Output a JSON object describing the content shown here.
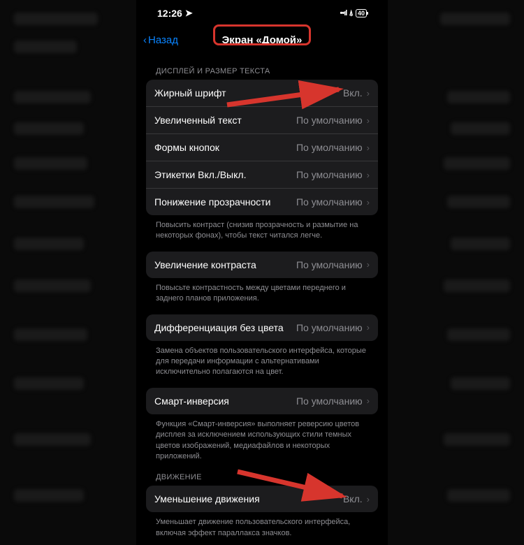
{
  "statusBar": {
    "time": "12:26",
    "batteryPct": "40"
  },
  "nav": {
    "back": "Назад",
    "title": "Экран «Домой»"
  },
  "sections": {
    "displayHeader": "ДИСПЛЕЙ И РАЗМЕР ТЕКСТА",
    "rows": {
      "bold": {
        "label": "Жирный шрифт",
        "value": "Вкл."
      },
      "larger": {
        "label": "Увеличенный текст",
        "value": "По умолчанию"
      },
      "buttonShapes": {
        "label": "Формы кнопок",
        "value": "По умолчанию"
      },
      "labels": {
        "label": "Этикетки Вкл./Выкл.",
        "value": "По умолчанию"
      },
      "reduceTransparency": {
        "label": "Понижение прозрачности",
        "value": "По умолчанию"
      },
      "contrast": {
        "label": "Увеличение контраста",
        "value": "По умолчанию"
      },
      "diffColor": {
        "label": "Дифференциация без цвета",
        "value": "По умолчанию"
      },
      "smartInvert": {
        "label": "Смарт-инверсия",
        "value": "По умолчанию"
      },
      "reduceMotion": {
        "label": "Уменьшение движения",
        "value": "Вкл."
      }
    },
    "footers": {
      "transparency": "Повысить контраст (снизив прозрачность и размытие на некоторых фонах), чтобы текст читался легче.",
      "contrast": "Повысьте контрастность между цветами переднего и заднего планов приложения.",
      "diffColor": "Замена объектов пользовательского интерфейса, которые для передачи информации с альтернативами исключительно полагаются на цвет.",
      "smartInvert": "Функция «Смарт-инверсия» выполняет реверсию цветов дисплея за исключением использующих стили темных цветов изображений, медиафайлов и некоторых приложений.",
      "reduceMotion": "Уменьшает движение пользовательского интерфейса, включая эффект параллакса значков."
    },
    "motionHeader": "ДВИЖЕНИЕ"
  }
}
